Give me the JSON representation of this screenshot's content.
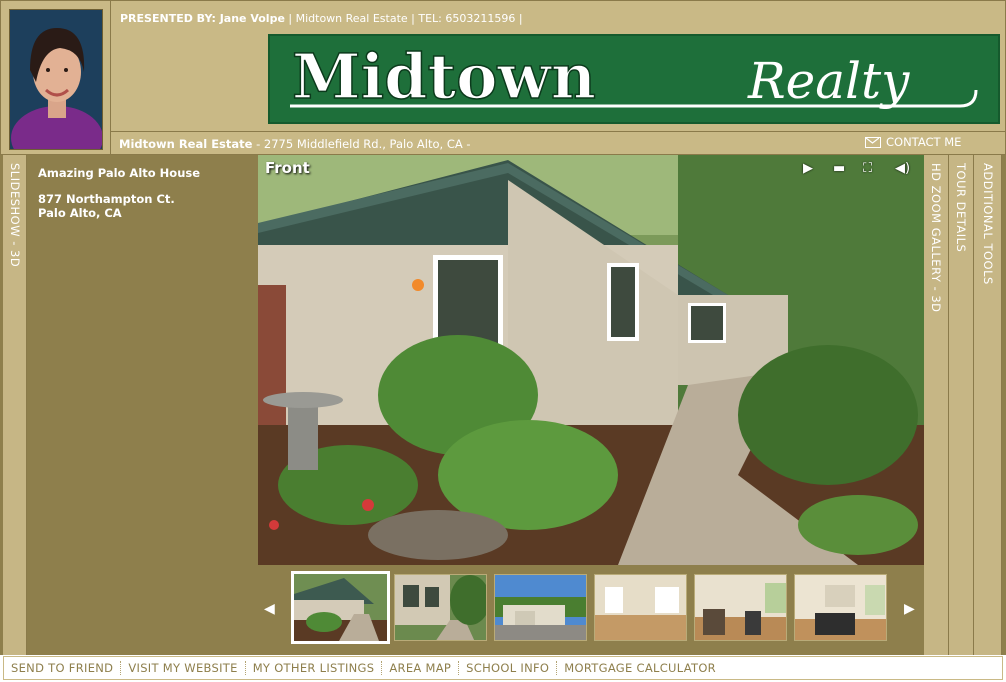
{
  "header": {
    "presented_by_label": "PRESENTED BY: Jane Volpe",
    "presented_rest": " | Midtown Real Estate | TEL: 6503211596 |",
    "logo_main": "Midtown",
    "logo_script": "Realty",
    "company_name": "Midtown Real Estate",
    "company_address": " - 2775 Middlefield Rd., Palo Alto, CA -",
    "contact_label": "CONTACT ME"
  },
  "tabs": {
    "left": "SLIDESHOW - 3D",
    "hd_zoom": "HD ZOOM GALLERY - 3D",
    "tour_details": "TOUR DETAILS",
    "additional_tools": "ADDITIONAL TOOLS"
  },
  "listing": {
    "title": "Amazing Palo Alto House",
    "street": "877 Northampton Ct.",
    "city": "Palo Alto, CA"
  },
  "photo": {
    "caption": "Front",
    "controls": [
      "play-icon",
      "comment-icon",
      "fullscreen-icon",
      "sound-icon"
    ]
  },
  "thumbnails": [
    "front-yard",
    "walkway",
    "front-exterior",
    "living-room",
    "dining-room",
    "family-room"
  ],
  "footer": {
    "links": [
      "SEND TO FRIEND",
      "VISIT MY WEBSITE",
      "MY OTHER LISTINGS",
      "AREA MAP",
      "SCHOOL INFO",
      "MORTGAGE CALCULATOR"
    ]
  },
  "colors": {
    "gold": "#c9b986",
    "olive": "#8e7f4c",
    "logo_green": "#1e6f3a"
  }
}
